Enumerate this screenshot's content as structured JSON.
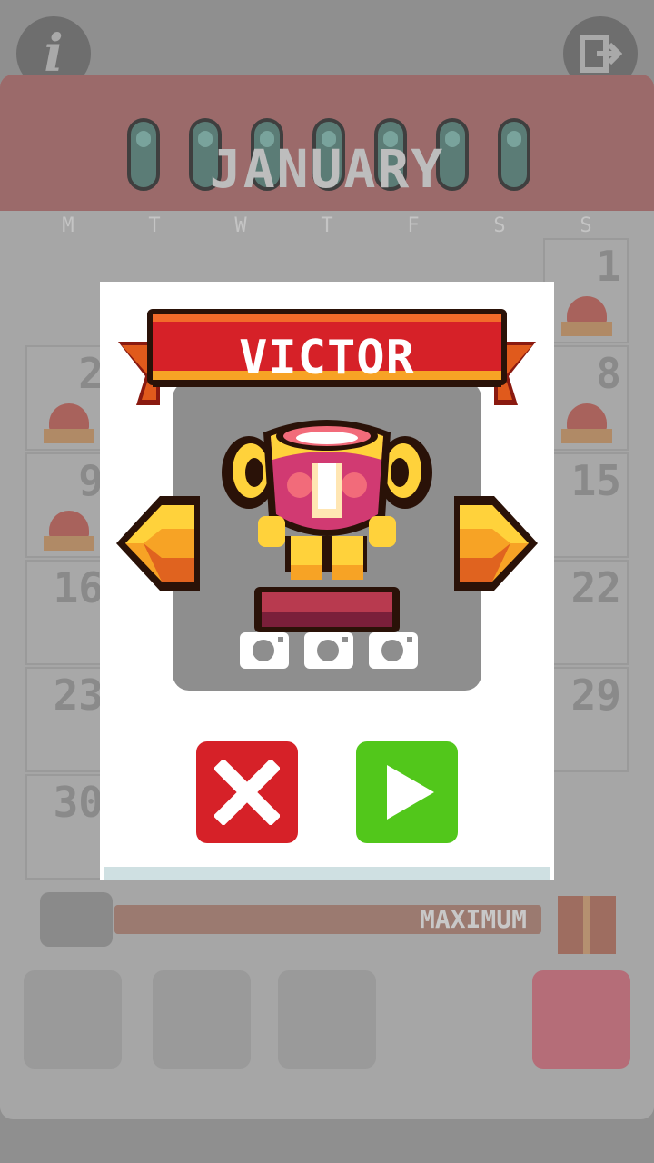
{
  "calendar": {
    "month": "JANUARY",
    "weekdays": [
      "M",
      "T",
      "W",
      "T",
      "F",
      "S",
      "S"
    ],
    "days": [
      {
        "label": "1",
        "cake": true
      },
      {
        "label": "2",
        "cake": true
      },
      {
        "label": "8",
        "cake": true
      },
      {
        "label": "9",
        "cake": true
      },
      {
        "label": "15",
        "cake": false
      },
      {
        "label": "16",
        "cake": false
      },
      {
        "label": "22",
        "cake": false
      },
      {
        "label": "23",
        "cake": false
      },
      {
        "label": "29",
        "cake": false
      },
      {
        "label": "30",
        "cake": false
      }
    ],
    "progress_label": "MAXIMUM"
  },
  "modal": {
    "title": "VICTOR",
    "icons": [
      "trophy-character-icon",
      "camera-icon",
      "arrow-left-icon",
      "arrow-right-icon",
      "close-icon",
      "play-icon"
    ],
    "camera_count": 3
  },
  "colors": {
    "banner_red": "#d62128",
    "close_red": "#d62128",
    "play_green": "#52c71b",
    "arrow_orange": "#f7a325"
  }
}
